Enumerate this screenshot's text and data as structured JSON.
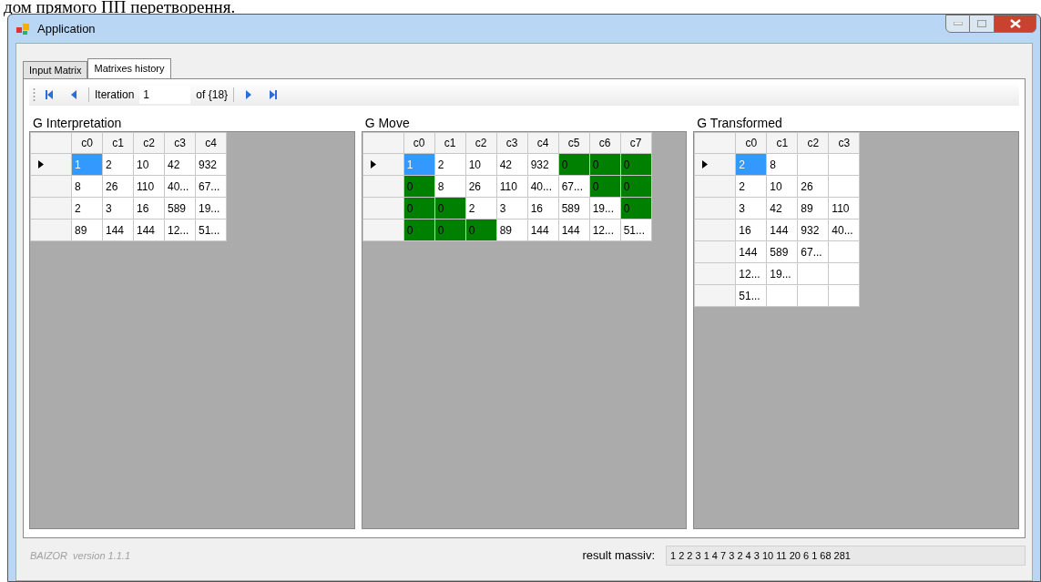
{
  "page_caption": "дом прямого ПП перетворення.",
  "window": {
    "title": "Application"
  },
  "tabs": [
    {
      "label": "Input Matrix",
      "selected": false
    },
    {
      "label": "Matrixes history",
      "selected": true
    }
  ],
  "navigator": {
    "label": "Iteration",
    "value": "1",
    "count": "of {18}"
  },
  "grids": [
    {
      "title": "G Interpretation",
      "columns": [
        "c0",
        "c1",
        "c2",
        "c3",
        "c4"
      ],
      "rows": [
        {
          "current": true,
          "cells": [
            {
              "text": "1",
              "selected": true,
              "highlighted": false
            },
            {
              "text": "2",
              "selected": false,
              "highlighted": false
            },
            {
              "text": "10",
              "selected": false,
              "highlighted": false
            },
            {
              "text": "42",
              "selected": false,
              "highlighted": false
            },
            {
              "text": "932",
              "selected": false,
              "highlighted": false
            }
          ]
        },
        {
          "current": false,
          "cells": [
            {
              "text": "8",
              "selected": false,
              "highlighted": false
            },
            {
              "text": "26",
              "selected": false,
              "highlighted": false
            },
            {
              "text": "110",
              "selected": false,
              "highlighted": false
            },
            {
              "text": "40...",
              "selected": false,
              "highlighted": false
            },
            {
              "text": "67...",
              "selected": false,
              "highlighted": false
            }
          ]
        },
        {
          "current": false,
          "cells": [
            {
              "text": "2",
              "selected": false,
              "highlighted": false
            },
            {
              "text": "3",
              "selected": false,
              "highlighted": false
            },
            {
              "text": "16",
              "selected": false,
              "highlighted": false
            },
            {
              "text": "589",
              "selected": false,
              "highlighted": false
            },
            {
              "text": "19...",
              "selected": false,
              "highlighted": false
            }
          ]
        },
        {
          "current": false,
          "cells": [
            {
              "text": "89",
              "selected": false,
              "highlighted": false
            },
            {
              "text": "144",
              "selected": false,
              "highlighted": false
            },
            {
              "text": "144",
              "selected": false,
              "highlighted": false
            },
            {
              "text": "12...",
              "selected": false,
              "highlighted": false
            },
            {
              "text": "51...",
              "selected": false,
              "highlighted": false
            }
          ]
        }
      ]
    },
    {
      "title": "G Move",
      "columns": [
        "c0",
        "c1",
        "c2",
        "c3",
        "c4",
        "c5",
        "c6",
        "c7"
      ],
      "rows": [
        {
          "current": true,
          "cells": [
            {
              "text": "1",
              "selected": true,
              "highlighted": false
            },
            {
              "text": "2",
              "selected": false,
              "highlighted": false
            },
            {
              "text": "10",
              "selected": false,
              "highlighted": false
            },
            {
              "text": "42",
              "selected": false,
              "highlighted": false
            },
            {
              "text": "932",
              "selected": false,
              "highlighted": false
            },
            {
              "text": "0",
              "selected": false,
              "highlighted": true
            },
            {
              "text": "0",
              "selected": false,
              "highlighted": true
            },
            {
              "text": "0",
              "selected": false,
              "highlighted": true
            }
          ]
        },
        {
          "current": false,
          "cells": [
            {
              "text": "0",
              "selected": false,
              "highlighted": true
            },
            {
              "text": "8",
              "selected": false,
              "highlighted": false
            },
            {
              "text": "26",
              "selected": false,
              "highlighted": false
            },
            {
              "text": "110",
              "selected": false,
              "highlighted": false
            },
            {
              "text": "40...",
              "selected": false,
              "highlighted": false
            },
            {
              "text": "67...",
              "selected": false,
              "highlighted": false
            },
            {
              "text": "0",
              "selected": false,
              "highlighted": true
            },
            {
              "text": "0",
              "selected": false,
              "highlighted": true
            }
          ]
        },
        {
          "current": false,
          "cells": [
            {
              "text": "0",
              "selected": false,
              "highlighted": true
            },
            {
              "text": "0",
              "selected": false,
              "highlighted": true
            },
            {
              "text": "2",
              "selected": false,
              "highlighted": false
            },
            {
              "text": "3",
              "selected": false,
              "highlighted": false
            },
            {
              "text": "16",
              "selected": false,
              "highlighted": false
            },
            {
              "text": "589",
              "selected": false,
              "highlighted": false
            },
            {
              "text": "19...",
              "selected": false,
              "highlighted": false
            },
            {
              "text": "0",
              "selected": false,
              "highlighted": true
            }
          ]
        },
        {
          "current": false,
          "cells": [
            {
              "text": "0",
              "selected": false,
              "highlighted": true
            },
            {
              "text": "0",
              "selected": false,
              "highlighted": true
            },
            {
              "text": "0",
              "selected": false,
              "highlighted": true
            },
            {
              "text": "89",
              "selected": false,
              "highlighted": false
            },
            {
              "text": "144",
              "selected": false,
              "highlighted": false
            },
            {
              "text": "144",
              "selected": false,
              "highlighted": false
            },
            {
              "text": "12...",
              "selected": false,
              "highlighted": false
            },
            {
              "text": "51...",
              "selected": false,
              "highlighted": false
            }
          ]
        }
      ]
    },
    {
      "title": "G Transformed",
      "columns": [
        "c0",
        "c1",
        "c2",
        "c3"
      ],
      "rows": [
        {
          "current": true,
          "cells": [
            {
              "text": "2",
              "selected": true,
              "highlighted": false
            },
            {
              "text": "8",
              "selected": false,
              "highlighted": false
            },
            null,
            null
          ]
        },
        {
          "current": false,
          "cells": [
            {
              "text": "2",
              "selected": false,
              "highlighted": false
            },
            {
              "text": "10",
              "selected": false,
              "highlighted": false
            },
            {
              "text": "26",
              "selected": false,
              "highlighted": false
            },
            null
          ]
        },
        {
          "current": false,
          "cells": [
            {
              "text": "3",
              "selected": false,
              "highlighted": false
            },
            {
              "text": "42",
              "selected": false,
              "highlighted": false
            },
            {
              "text": "89",
              "selected": false,
              "highlighted": false
            },
            {
              "text": "110",
              "selected": false,
              "highlighted": false
            }
          ]
        },
        {
          "current": false,
          "cells": [
            {
              "text": "16",
              "selected": false,
              "highlighted": false
            },
            {
              "text": "144",
              "selected": false,
              "highlighted": false
            },
            {
              "text": "932",
              "selected": false,
              "highlighted": false
            },
            {
              "text": "40...",
              "selected": false,
              "highlighted": false
            }
          ]
        },
        {
          "current": false,
          "cells": [
            {
              "text": "144",
              "selected": false,
              "highlighted": false
            },
            {
              "text": "589",
              "selected": false,
              "highlighted": false
            },
            {
              "text": "67...",
              "selected": false,
              "highlighted": false
            },
            null
          ]
        },
        {
          "current": false,
          "cells": [
            {
              "text": "12...",
              "selected": false,
              "highlighted": false
            },
            {
              "text": "19...",
              "selected": false,
              "highlighted": false
            },
            null,
            null
          ]
        },
        {
          "current": false,
          "cells": [
            {
              "text": "51...",
              "selected": false,
              "highlighted": false
            },
            null,
            null,
            null
          ]
        }
      ]
    }
  ],
  "status_bar": {
    "version": "BAIZOR  version 1.1.1",
    "result_label": "result massiv:",
    "result_value": "1 2 2 3 1 4 7 3 2 4 3 10 11 20 6 1 68 281"
  }
}
